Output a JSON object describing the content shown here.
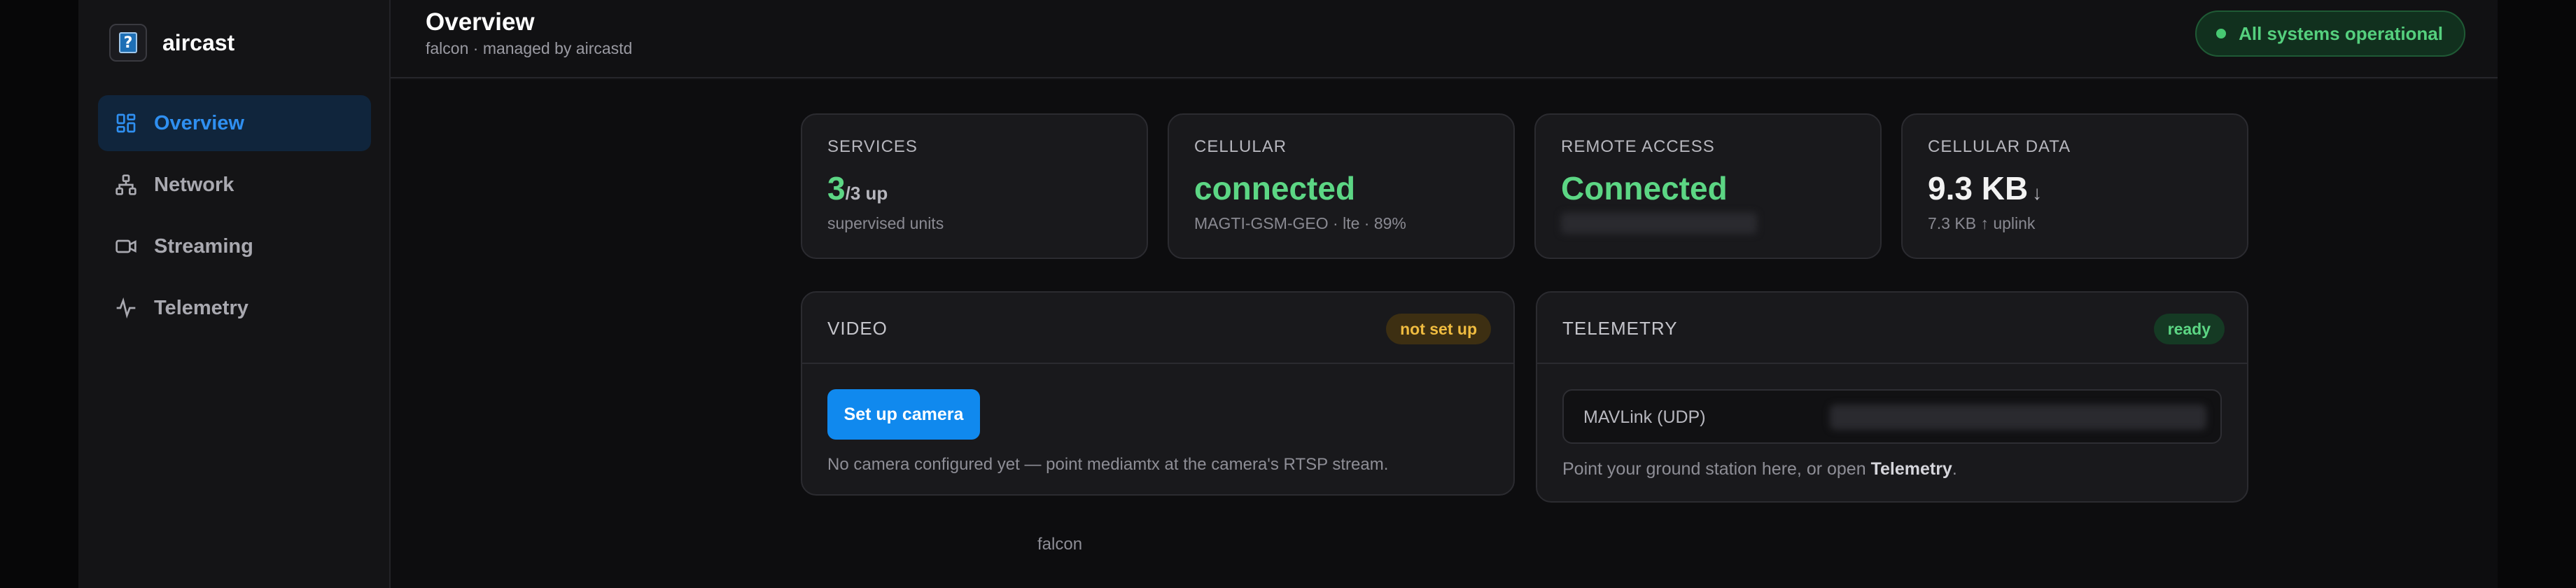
{
  "brand": {
    "name": "aircast",
    "logo_glyph": "?"
  },
  "nav": {
    "items": [
      {
        "label": "Overview",
        "icon": "dashboard-icon",
        "active": true
      },
      {
        "label": "Network",
        "icon": "network-icon",
        "active": false
      },
      {
        "label": "Streaming",
        "icon": "video-icon",
        "active": false
      },
      {
        "label": "Telemetry",
        "icon": "activity-icon",
        "active": false
      }
    ]
  },
  "header": {
    "title": "Overview",
    "subtitle": "falcon · managed by aircastd",
    "status": "All systems operational"
  },
  "stats": {
    "services": {
      "label": "SERVICES",
      "value": "3",
      "unit": "/3 up",
      "sub": "supervised units"
    },
    "cellular": {
      "label": "CELLULAR",
      "value": "connected",
      "sub": "MAGTI-GSM-GEO · lte · 89%"
    },
    "remote": {
      "label": "REMOTE ACCESS",
      "value": "Connected"
    },
    "data": {
      "label": "CELLULAR DATA",
      "value": "9.3 KB",
      "arrow": "↓",
      "sub": "7.3 KB ↑ uplink"
    }
  },
  "video": {
    "title": "VIDEO",
    "badge": "not set up",
    "button": "Set up camera",
    "note": "No camera configured yet — point mediamtx at the camera's RTSP stream."
  },
  "telemetry": {
    "title": "TELEMETRY",
    "badge": "ready",
    "endpoint_label": "MAVLink (UDP)",
    "note_prefix": "Point your ground station here, or open ",
    "note_link": "Telemetry",
    "note_suffix": "."
  },
  "footer": {
    "host": "falcon"
  },
  "colors": {
    "accent": "#1089ee",
    "success": "#5cd684",
    "warning": "#f0bc40"
  }
}
